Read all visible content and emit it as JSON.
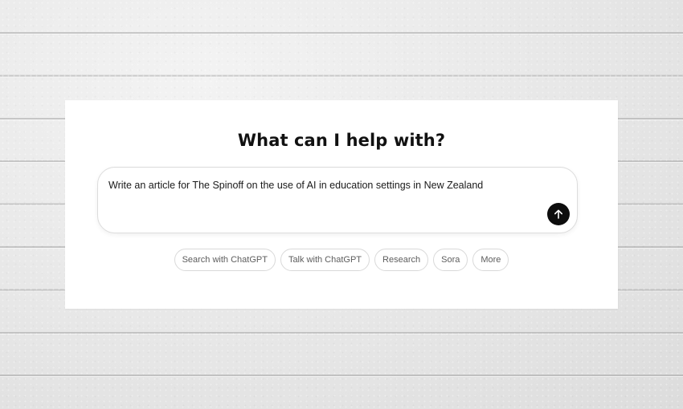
{
  "heading": "What can I help with?",
  "composer": {
    "text": "Write an article for The Spinoff on the use of AI in education settings in New Zealand",
    "send_icon": "arrow-up-icon"
  },
  "chips": [
    {
      "label": "Search with ChatGPT"
    },
    {
      "label": "Talk with ChatGPT"
    },
    {
      "label": "Research"
    },
    {
      "label": "Sora"
    },
    {
      "label": "More"
    }
  ],
  "colors": {
    "send_button": "#0d0d0d",
    "card_background": "#ffffff",
    "page_background": "#ebebeb"
  }
}
